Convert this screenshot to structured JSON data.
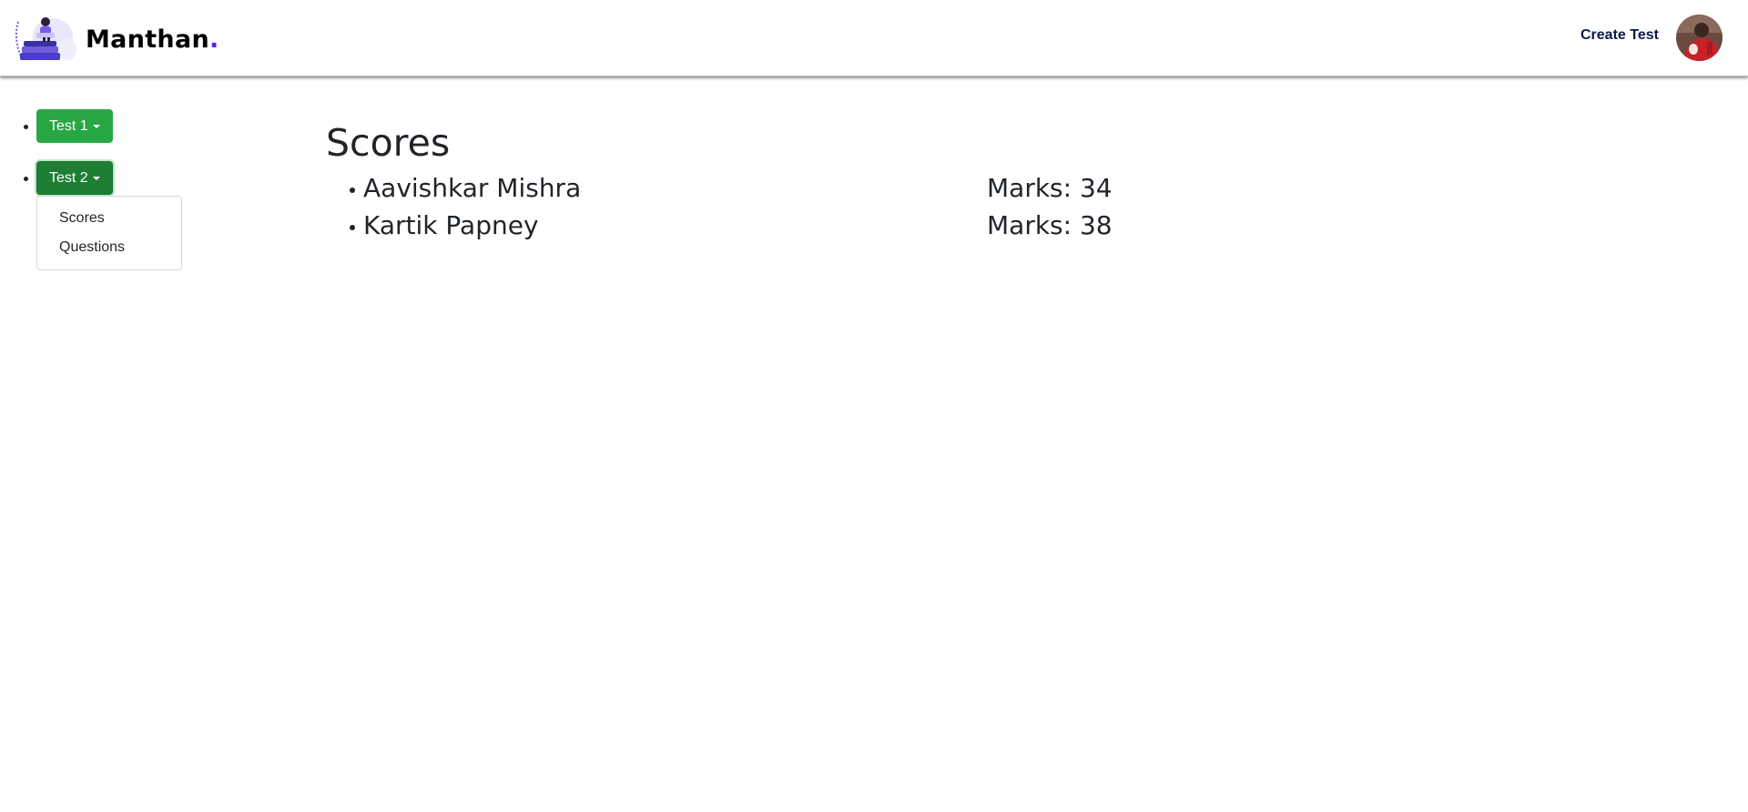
{
  "header": {
    "brand_name": "Manthan",
    "brand_dot": ".",
    "create_test_label": "Create Test"
  },
  "sidebar": {
    "tests": [
      {
        "label": "Test 1",
        "expanded": false
      },
      {
        "label": "Test 2",
        "expanded": true,
        "menu": [
          {
            "label": "Scores"
          },
          {
            "label": "Questions"
          }
        ]
      }
    ]
  },
  "main": {
    "title": "Scores",
    "scores": [
      {
        "name": "Aavishkar Mishra",
        "marks": "Marks: 34"
      },
      {
        "name": "Kartik Papney",
        "marks": "Marks: 38"
      }
    ]
  },
  "colors": {
    "button_green": "#28a745",
    "button_green_active": "#1e7e34",
    "brand_accent": "#5b21e6"
  }
}
